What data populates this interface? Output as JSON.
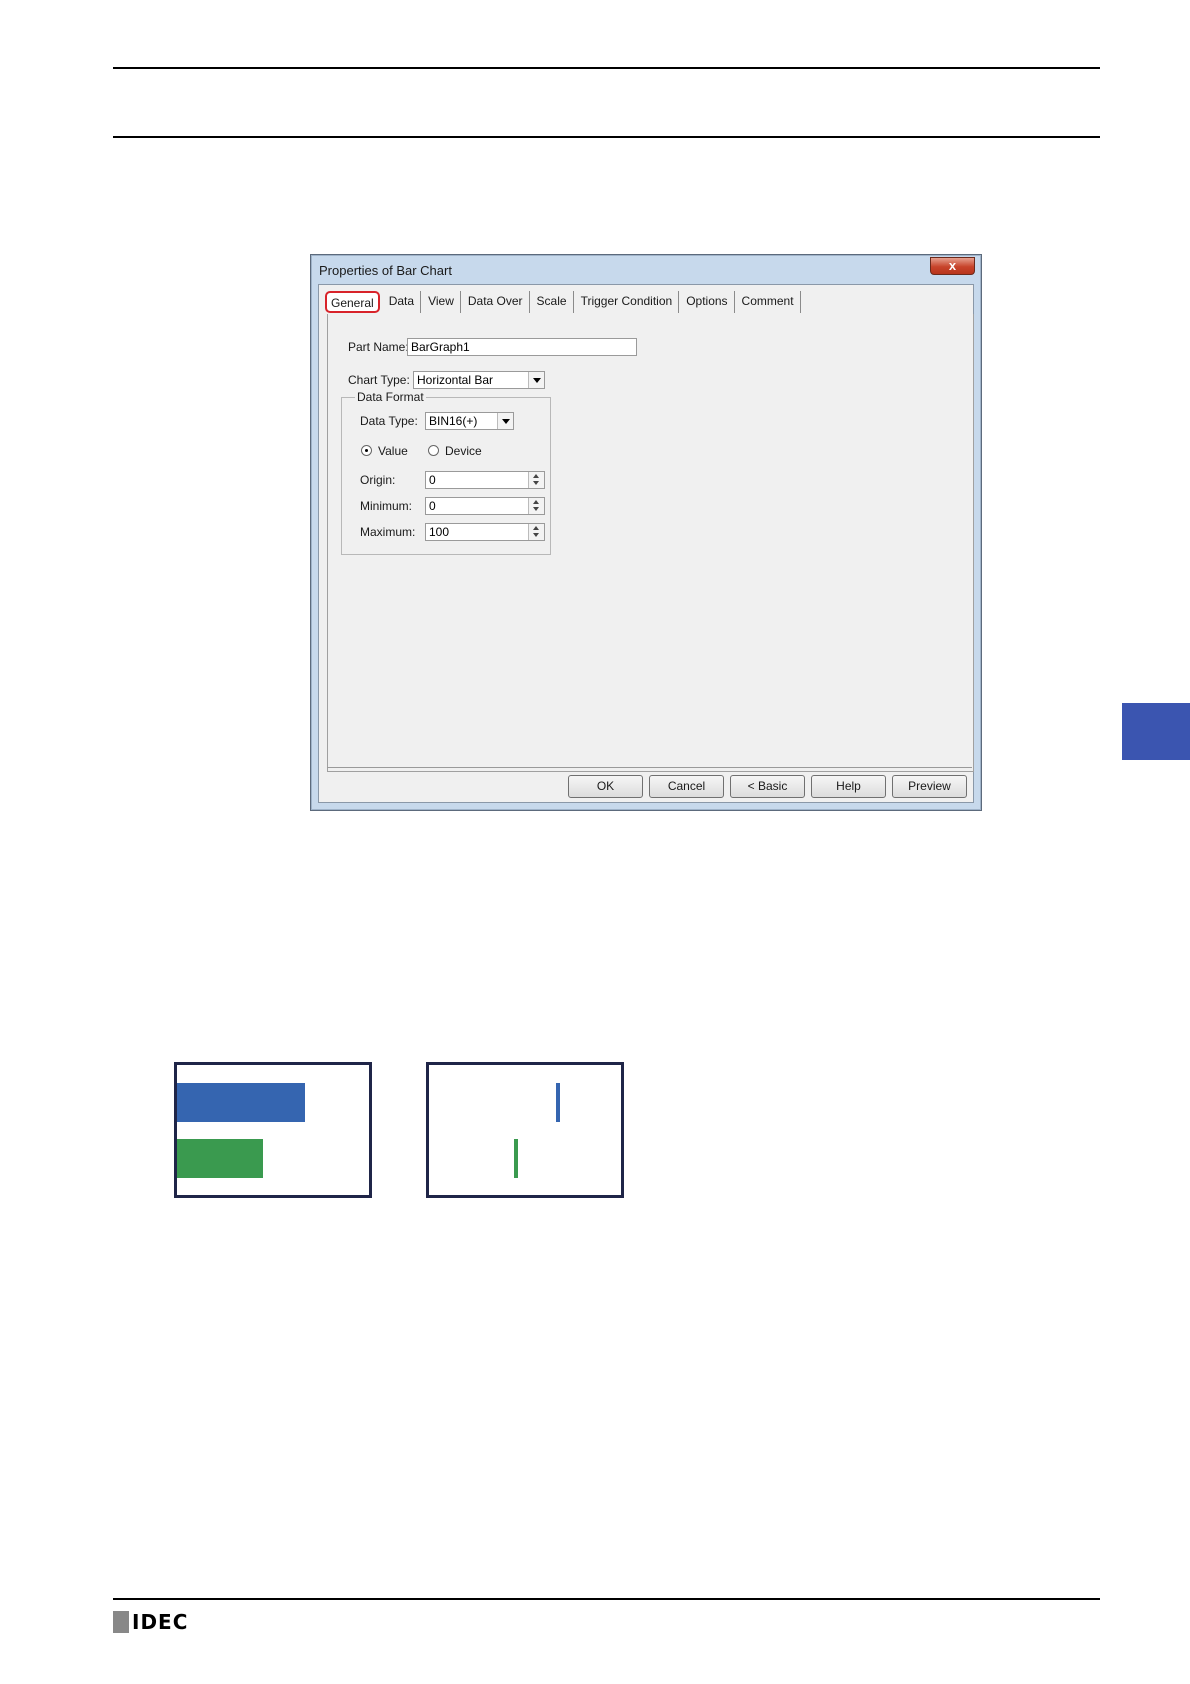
{
  "dialog": {
    "title": "Properties of Bar Chart",
    "close_glyph": "x",
    "tabs": [
      {
        "label": "General"
      },
      {
        "label": "Data"
      },
      {
        "label": "View"
      },
      {
        "label": "Data Over"
      },
      {
        "label": "Scale"
      },
      {
        "label": "Trigger Condition"
      },
      {
        "label": "Options"
      },
      {
        "label": "Comment"
      }
    ],
    "part_name": {
      "label": "Part Name:",
      "value": "BarGraph1"
    },
    "chart_type": {
      "label": "Chart Type:",
      "value": "Horizontal Bar"
    },
    "data_format": {
      "legend": "Data Format",
      "data_type": {
        "label": "Data Type:",
        "value": "BIN16(+)"
      },
      "value_radio": {
        "label": "Value",
        "checked": true
      },
      "device_radio": {
        "label": "Device",
        "checked": false
      },
      "origin": {
        "label": "Origin:",
        "value": "0"
      },
      "minimum": {
        "label": "Minimum:",
        "value": "0"
      },
      "maximum": {
        "label": "Maximum:",
        "value": "100"
      }
    },
    "buttons": {
      "ok": "OK",
      "cancel": "Cancel",
      "basic": "< Basic",
      "help": "Help",
      "preview": "Preview"
    }
  },
  "colors": {
    "accent_side_tab": "#3b55b0",
    "bar_blue": "#3565b0",
    "bar_green": "#3a9a4f",
    "highlight_red": "#d8232a"
  },
  "samples": [
    {
      "bars": [
        {
          "color": "blue",
          "fill": 0.65
        },
        {
          "color": "green",
          "fill": 0.43
        }
      ]
    },
    {
      "bars": [
        {
          "color": "blue",
          "marker": 0.66
        },
        {
          "color": "green",
          "marker": 0.44
        }
      ]
    }
  ],
  "footer": {
    "logo": "IDEC"
  }
}
